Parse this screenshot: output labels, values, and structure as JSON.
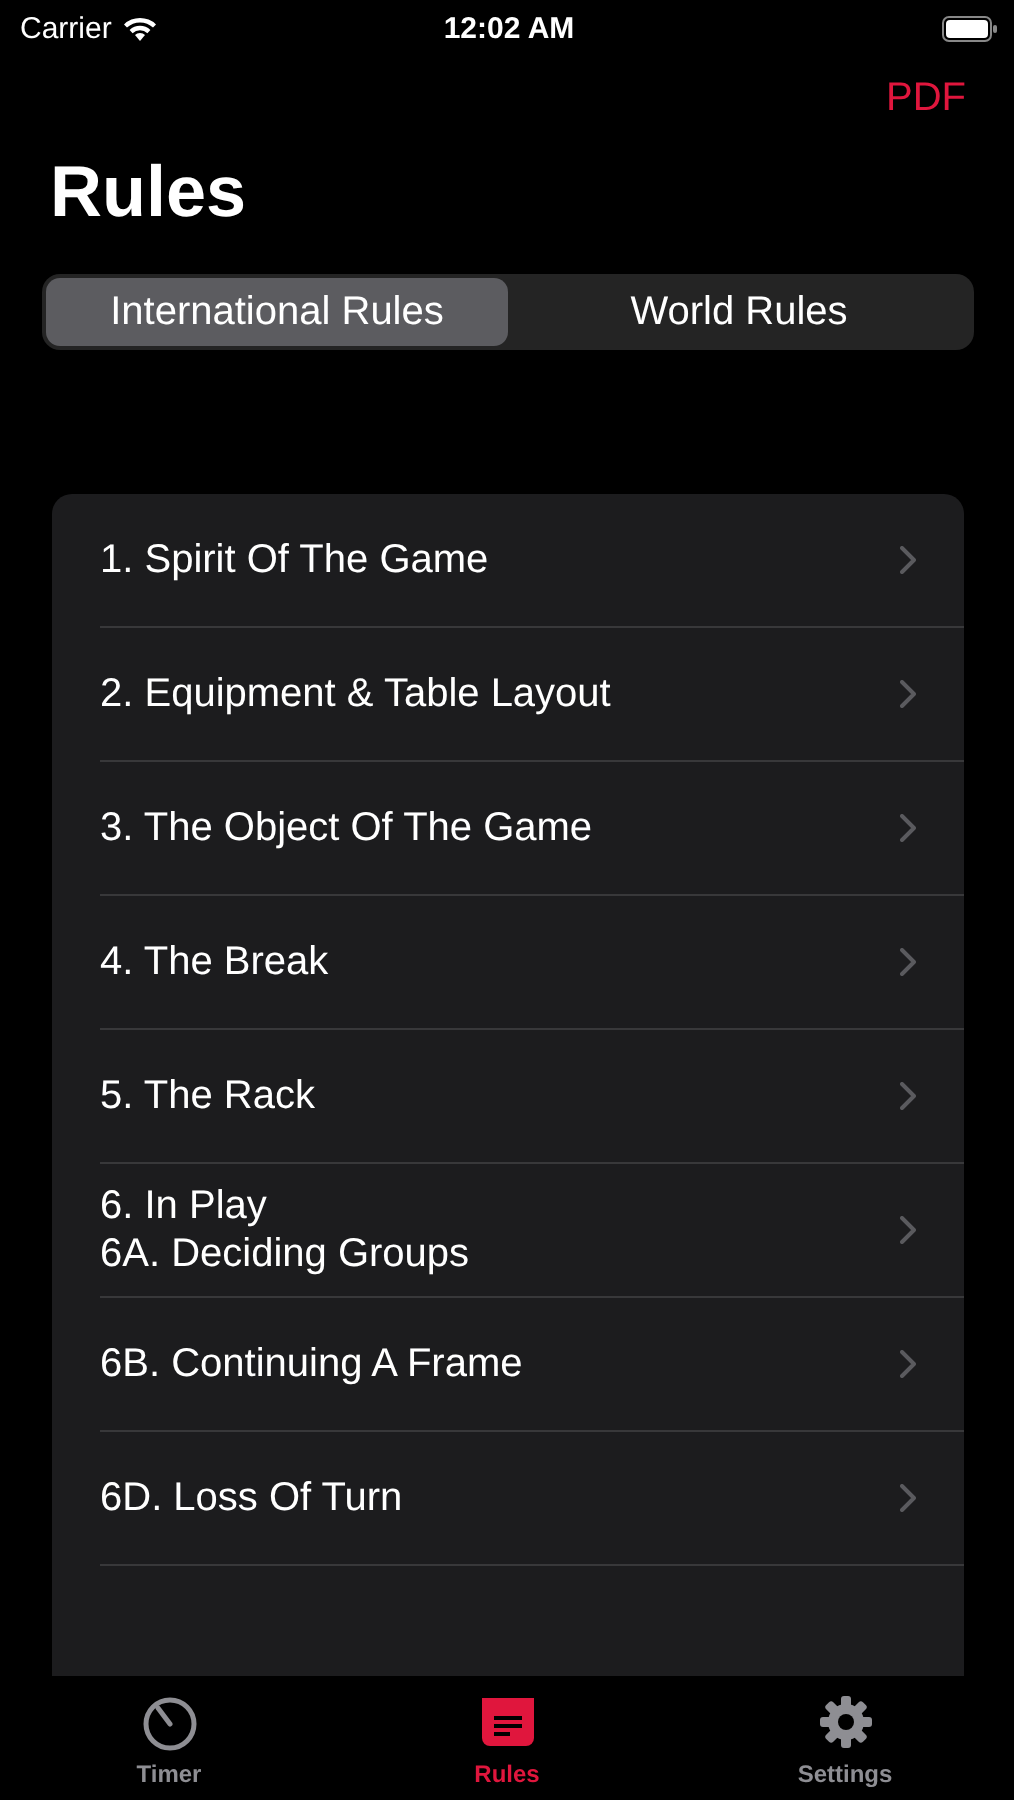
{
  "status_bar": {
    "carrier": "Carrier",
    "time": "12:02 AM"
  },
  "nav": {
    "action": "PDF",
    "title": "Rules"
  },
  "segments": [
    {
      "label": "International Rules",
      "selected": true
    },
    {
      "label": "World Rules",
      "selected": false
    }
  ],
  "rules": [
    {
      "lines": [
        "1. Spirit Of The Game"
      ]
    },
    {
      "lines": [
        "2. Equipment & Table Layout"
      ]
    },
    {
      "lines": [
        "3. The Object Of The Game"
      ]
    },
    {
      "lines": [
        "4. The Break"
      ]
    },
    {
      "lines": [
        "5. The Rack"
      ]
    },
    {
      "lines": [
        "6. In Play",
        "6A. Deciding Groups"
      ]
    },
    {
      "lines": [
        "6B. Continuing A Frame"
      ]
    },
    {
      "lines": [
        "6D. Loss Of Turn"
      ]
    }
  ],
  "tab_bar": [
    {
      "label": "Timer",
      "kind": "timer",
      "selected": false
    },
    {
      "label": "Rules",
      "kind": "rules",
      "selected": true
    },
    {
      "label": "Settings",
      "kind": "settings",
      "selected": false
    }
  ]
}
